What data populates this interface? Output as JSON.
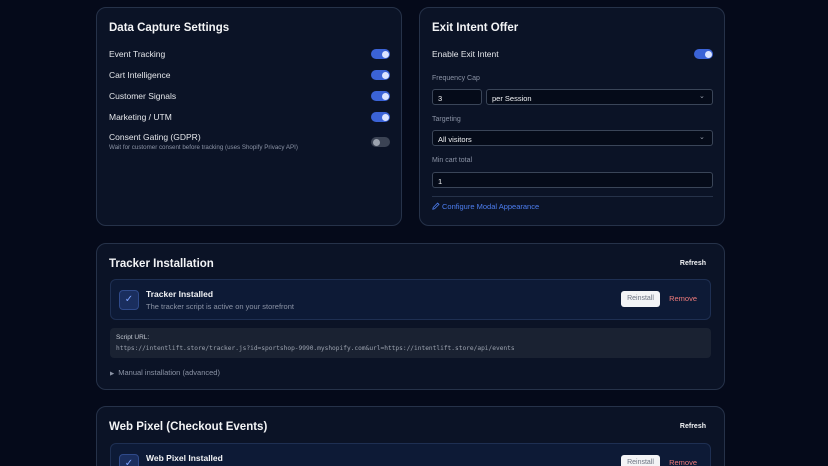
{
  "data_capture": {
    "title": "Data Capture Settings",
    "items": [
      {
        "label": "Event Tracking",
        "enabled": true
      },
      {
        "label": "Cart Intelligence",
        "enabled": true
      },
      {
        "label": "Customer Signals",
        "enabled": true
      },
      {
        "label": "Marketing / UTM",
        "enabled": true
      },
      {
        "label": "Consent Gating (GDPR)",
        "enabled": false,
        "description": "Wait for customer consent before tracking (uses Shopify Privacy API)"
      }
    ]
  },
  "exit_intent": {
    "title": "Exit Intent Offer",
    "enable_label": "Enable Exit Intent",
    "enabled": true,
    "frequency_cap_label": "Frequency Cap",
    "frequency_value": "3",
    "frequency_unit": "per Session",
    "targeting_label": "Targeting",
    "targeting_value": "All visitors",
    "min_cart_label": "Min cart total",
    "min_cart_value": "1",
    "configure_link": "Configure Modal Appearance"
  },
  "tracker": {
    "title": "Tracker Installation",
    "refresh_label": "Refresh",
    "status_title": "Tracker Installed",
    "status_sub": "The tracker script is active on your storefront",
    "reinstall_label": "Reinstall",
    "remove_label": "Remove",
    "script_url_label": "Script URL:",
    "script_url": "https://intentlift.store/tracker.js?id=sportshop-9990.myshopify.com&url=https://intentlift.store/api/events",
    "manual_label": "Manual installation (advanced)"
  },
  "web_pixel": {
    "title": "Web Pixel (Checkout Events)",
    "refresh_label": "Refresh",
    "status_title": "Web Pixel Installed",
    "reinstall_label": "Reinstall",
    "remove_label": "Remove"
  },
  "colors": {
    "accent": "#3b63d6",
    "link": "#4d7ef0",
    "danger": "#ef7b7b",
    "background": "#050a1a",
    "card": "#0b1326"
  }
}
